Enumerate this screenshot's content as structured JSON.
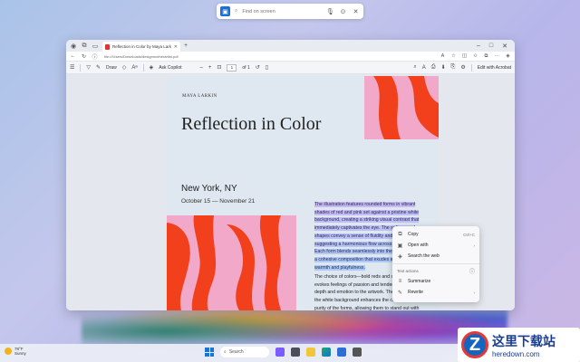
{
  "search_bar": {
    "placeholder": "Find on screen",
    "icons": [
      "search-icon",
      "mic-icon",
      "screenshot-icon",
      "close-icon"
    ]
  },
  "browser": {
    "tab_title": "Reflection in Color by Maya Larkin",
    "url": "file:///Users/Downloads/designmotherartist.pdf",
    "window_controls": [
      "minimize",
      "maximize",
      "close"
    ]
  },
  "pdf_toolbar": {
    "draw_label": "Draw",
    "ask_copilot_label": "Ask Copilot",
    "page_number": "1",
    "page_total": "of 1",
    "edit_label": "Edit with Acrobat"
  },
  "document": {
    "author": "MAYA LARKIN",
    "title": "Reflection in Color",
    "location": "New York, NY",
    "dates": "October 15 — November 21",
    "highlighted_paragraph": "The illustration features rounded forms in vibrant shades of red and pink set against a pristine white background, creating a striking visual contrast that immediately captivates the eye. The soft, curved shapes convey a sense of fluidity and movement, suggesting a harmonious flow across the canvas. Each form blends seamlessly into the next, forming a cohesive composition that exudes a sense of warmth and playfulness.",
    "paragraph": "The choice of colors—bold reds and soft pinks—evokes feelings of passion and tenderness, adding depth and emotion to the artwork. The simplicity of the white background enhances the clarity and purity of the forms, allowing them to stand out with clarity and impact. This illustration is not only aesthetically pleasing but also invites the viewer to interpret its abstract shapes and vibrant hues, offering a moment of visual delight and contemplation."
  },
  "context_menu": {
    "copy": "Copy",
    "copy_shortcut": "Ctrl+C",
    "open_with": "Open with",
    "search_web": "Search the web",
    "text_actions": "Text actions",
    "summarize": "Summarize",
    "rewrite": "Rewrite"
  },
  "taskbar": {
    "temperature": "78°F",
    "weather": "Sunny",
    "search_placeholder": "Search"
  },
  "watermark": {
    "text": "这里下载站",
    "url": "heredown.com"
  },
  "colors": {
    "accent": "#1a6ed8",
    "art_red": "#f2401c",
    "art_pink": "#f2a8c8",
    "highlight": "#c9b8f4"
  }
}
